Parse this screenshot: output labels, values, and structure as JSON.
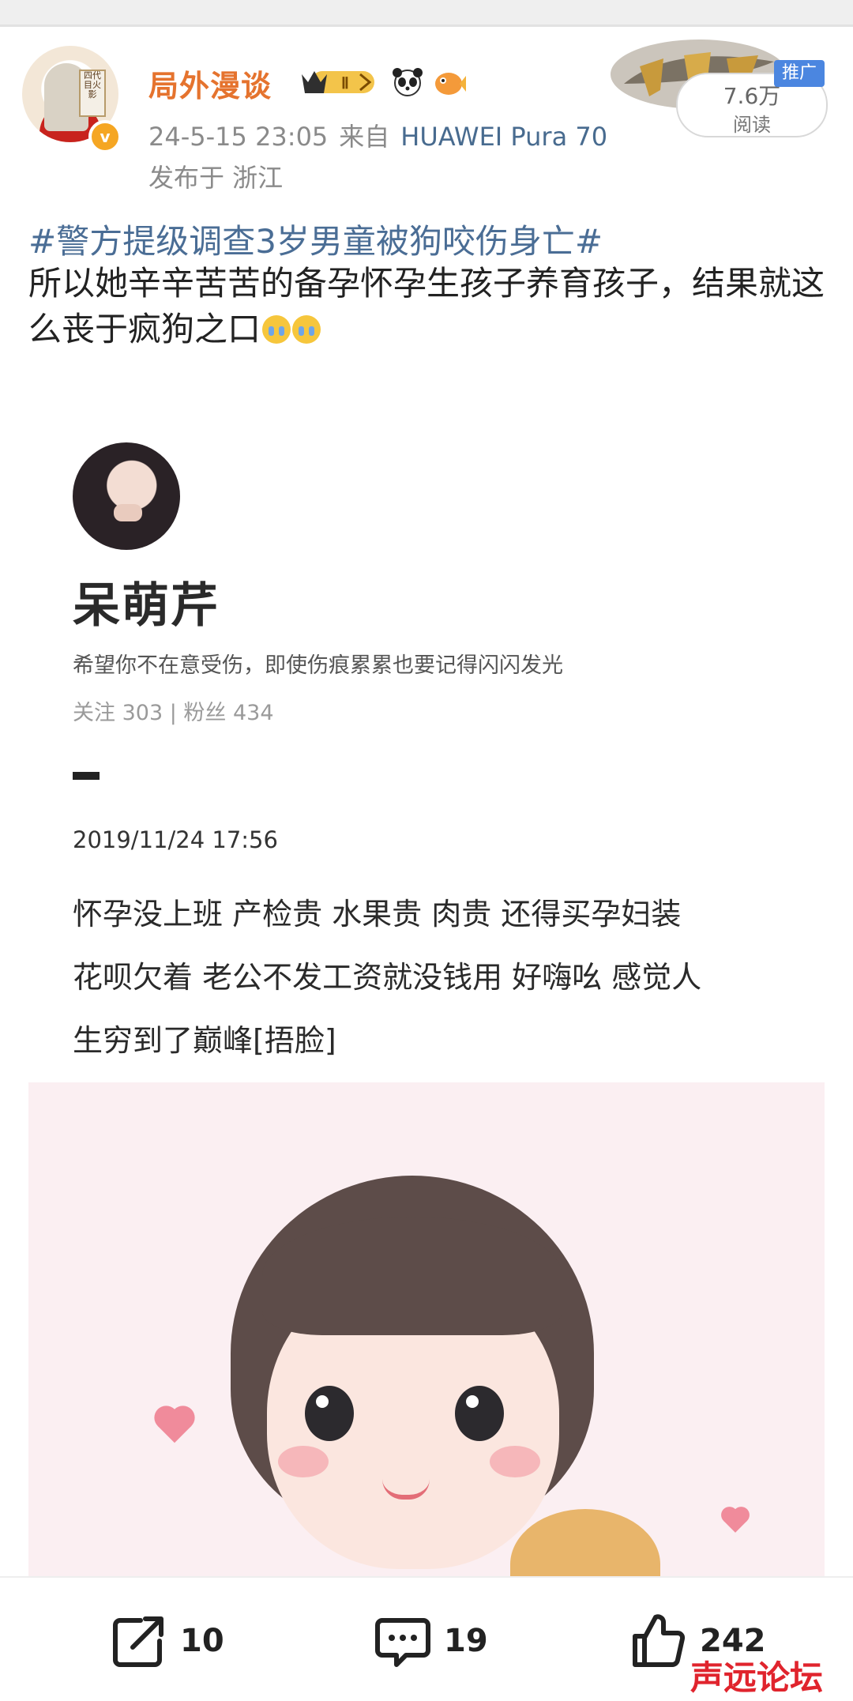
{
  "post": {
    "author": "局外漫谈",
    "time": "24-5-15 23:05",
    "source_label": "来自",
    "device": "HUAWEI Pura 70",
    "location": "发布于 浙江",
    "read_count": "7.6万",
    "read_label": "阅读",
    "promo_label": "推广",
    "hashtag": "#警方提级调查3岁男童被狗咬伤身亡#",
    "body": "所以她辛辛苦苦的备孕怀孕生孩子养育孩子，结果就这么丧于疯狗之口",
    "emojis": [
      "crying-face",
      "crying-face"
    ]
  },
  "embedded_screenshot": {
    "name": "呆萌芹",
    "bio": "希望你不在意受伤，即使伤痕累累也要记得闪闪发光",
    "stats": "关注 303 | 粉丝 434",
    "date": "2019/11/24 17:56",
    "lines": [
      "怀孕没上班  产检贵  水果贵 肉贵  还得买孕妇装",
      "花呗欠着 老公不发工资就没钱用  好嗨吆  感觉人",
      "生穷到了巅峰[捂脸]"
    ]
  },
  "actions": {
    "repost_count": "10",
    "comment_count": "19",
    "like_count": "242"
  },
  "colors": {
    "username": "#e5732e",
    "link": "#4a6d95",
    "promo": "#4b86e0",
    "watermark": "#e0242d"
  },
  "watermark_text": "声远论坛"
}
